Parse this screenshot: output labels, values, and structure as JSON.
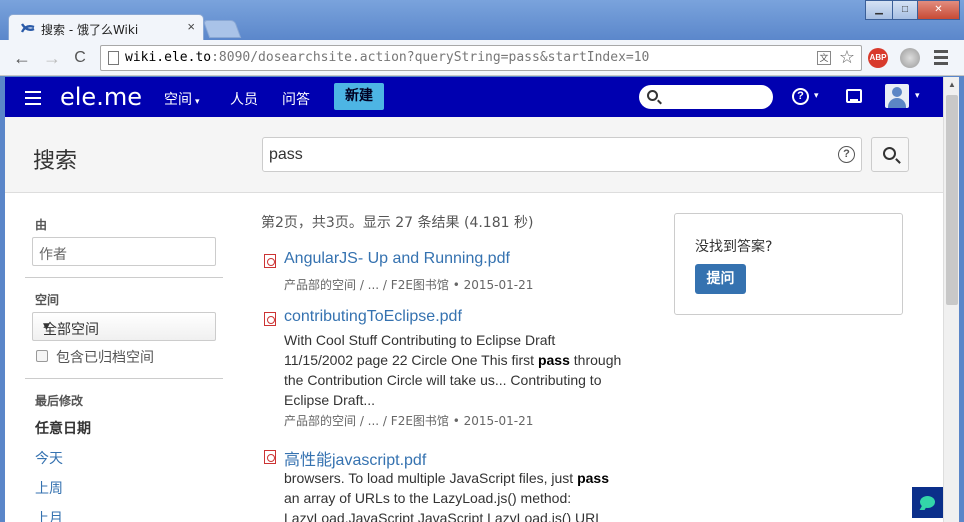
{
  "browser": {
    "tab_title": "搜索 - 饿了么Wiki",
    "tab_close": "×",
    "url_host": "wiki.ele.to",
    "url_rest": ":8090/dosearchsite.action?queryString=pass&startIndex=10",
    "back_glyph": "←",
    "forward_glyph": "→",
    "reload_glyph": "C",
    "star_glyph": "☆",
    "abp_label": "ABP",
    "win_min": "▁",
    "win_max": "□",
    "win_close": "✕"
  },
  "topnav": {
    "logo": "ele.me",
    "spaces": "空间",
    "people": "人员",
    "qa": "问答",
    "create": "新建",
    "help_glyph": "?",
    "caret": "▾"
  },
  "search": {
    "heading": "搜索",
    "query": "pass",
    "help_glyph": "?"
  },
  "filters": {
    "by_label": "由",
    "author_placeholder": "作者",
    "space_label": "空间",
    "space_value": "全部空间",
    "select_arrow": "▼",
    "include_archived": "包含已归档空间",
    "last_modified_label": "最后修改",
    "date_options": [
      "任意日期",
      "今天",
      "上周",
      "上月"
    ]
  },
  "results": {
    "summary": "第2页，共3页。显示 27 条结果 (4.181 秒)",
    "items": [
      {
        "title": "AngularJS- Up and Running.pdf",
        "excerpt_lines": [],
        "meta": "产品部的空间 / ... / F2E图书馆 • 2015-01-21"
      },
      {
        "title": "contributingToEclipse.pdf",
        "excerpt_lines": [
          [
            "With Cool Stuff Contributing to Eclipse Draft",
            "",
            ""
          ],
          [
            "11/15/2002 page 22 Circle One This first ",
            "pass",
            " through"
          ],
          [
            "the Contribution Circle will take us... Contributing to",
            "",
            ""
          ],
          [
            "Eclipse Draft...",
            "",
            ""
          ]
        ],
        "meta": "产品部的空间 / ... / F2E图书馆 • 2015-01-21"
      },
      {
        "title": "高性能javascript.pdf",
        "excerpt_lines": [
          [
            "browsers. To load multiple JavaScript files, just ",
            "pass",
            ""
          ],
          [
            "an array of URLs to the LazyLoad.js() method:",
            "",
            ""
          ],
          [
            "LazyLoad.JavaScript JavaScript LazyLoad.js() URL",
            "",
            ""
          ]
        ],
        "meta": ""
      }
    ]
  },
  "ask": {
    "question": "没找到答案?",
    "button": "提问"
  },
  "colors": {
    "nav_bg": "#0000b0",
    "accent_blue": "#3572b0",
    "create_btn": "#4db5e4"
  }
}
